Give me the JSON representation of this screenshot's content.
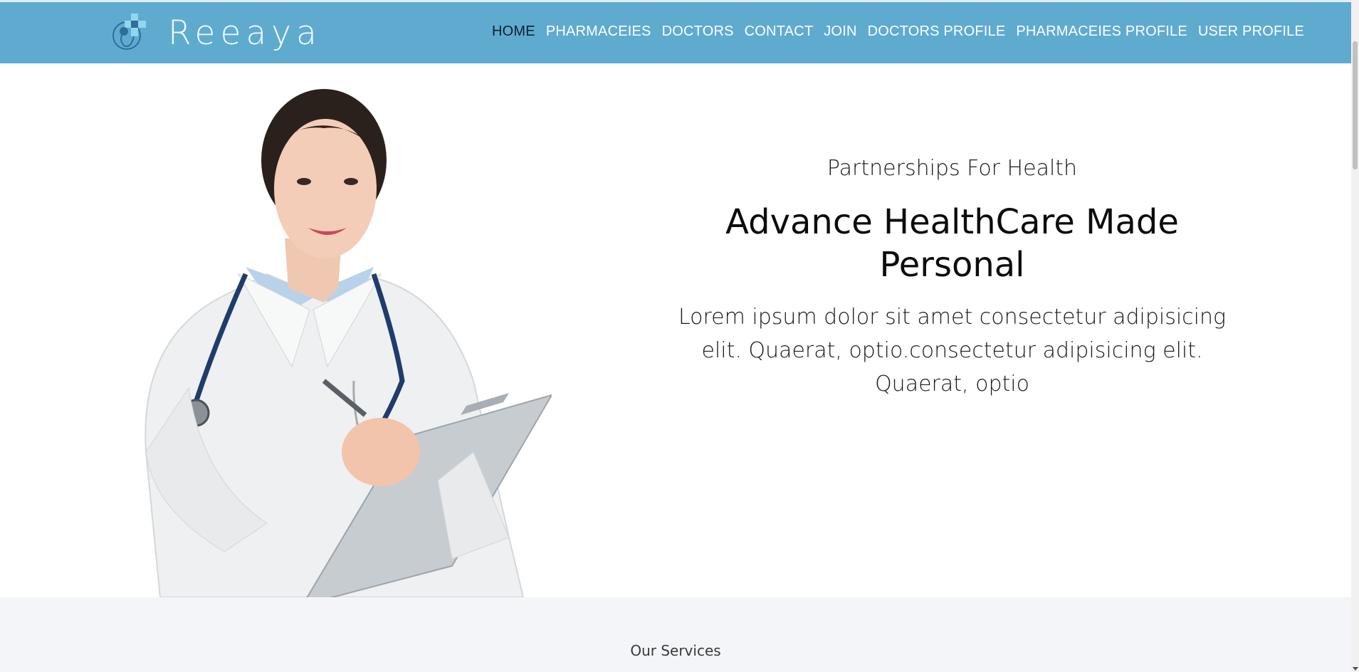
{
  "brand": {
    "name": "Reeaya",
    "logo_icon": "medical-cross-stethoscope-logo"
  },
  "nav": {
    "items": [
      {
        "label": "HOME",
        "active": true
      },
      {
        "label": "PHARMACEIES",
        "active": false
      },
      {
        "label": "DOCTORS",
        "active": false
      },
      {
        "label": "CONTACT",
        "active": false
      },
      {
        "label": "JOIN",
        "active": false
      },
      {
        "label": "DOCTORS PROFILE",
        "active": false
      },
      {
        "label": "PHARMACEIES PROFILE",
        "active": false
      },
      {
        "label": "USER PROFILE",
        "active": false
      }
    ]
  },
  "hero": {
    "eyebrow": "Partnerships For Health",
    "headline": "Advance HealthCare Made Personal",
    "lead": "Lorem ipsum dolor sit amet consectetur adipisicing elit. Quaerat, optio.consectetur adipisicing elit. Quaerat, optio",
    "image": "doctor-with-clipboard-photo"
  },
  "services": {
    "title": "Our Services"
  },
  "colors": {
    "navbar": "#5fabd0",
    "nav_active": "#0b1f2e",
    "services_bg": "#f4f5f9"
  }
}
